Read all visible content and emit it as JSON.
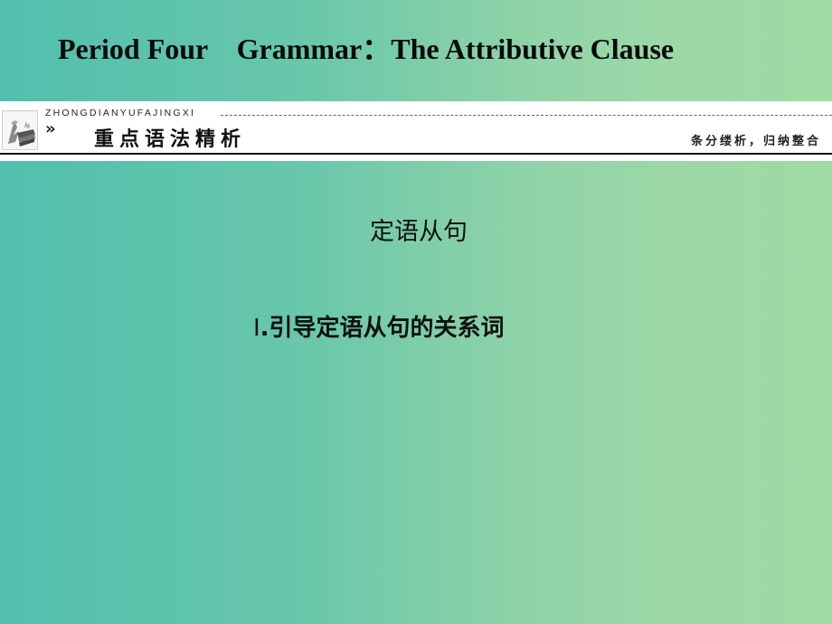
{
  "slide": {
    "title": "Period Four    Grammar：The Attributive Clause",
    "banner": {
      "icon": "books-icon",
      "pinyin": "ZHONGDIANYUFAJINGXI",
      "chevron": "»",
      "heading": "重点语法精析",
      "subheading": "条分缕析，归纳整合"
    },
    "section_title": "定语从句",
    "subsection": {
      "numeral": "Ⅰ",
      "text": ".引导定语从句的关系词"
    },
    "colors": {
      "gradient_left": "#52bfae",
      "gradient_right": "#a0daa5",
      "banner_bg": "#ffffff",
      "text": "#111111"
    }
  }
}
